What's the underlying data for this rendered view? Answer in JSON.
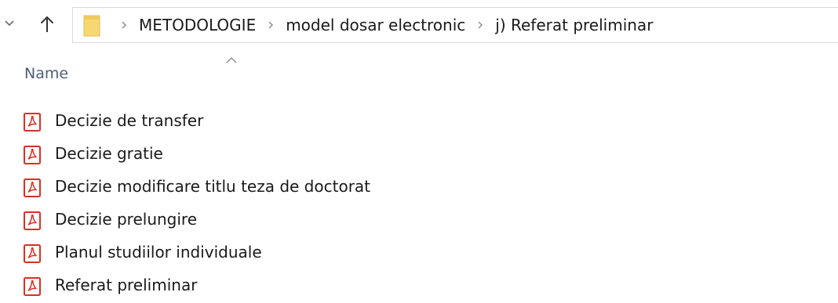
{
  "window": {
    "title": "j) Referat preliminar"
  },
  "address_bar": {
    "path": [
      "METODOLOGIE",
      "model dosar electronic",
      "j) Referat preliminar"
    ]
  },
  "column": {
    "name_label": "Name",
    "sort": "ascending"
  },
  "files": [
    {
      "name": "Decizie de transfer",
      "icon": "pdf-icon"
    },
    {
      "name": "Decizie gratie",
      "icon": "pdf-icon"
    },
    {
      "name": "Decizie modificare titlu teza de doctorat",
      "icon": "pdf-icon"
    },
    {
      "name": "Decizie prelungire",
      "icon": "pdf-icon"
    },
    {
      "name": "Planul studiilor individuale",
      "icon": "pdf-icon"
    },
    {
      "name": "Referat preliminar",
      "icon": "pdf-icon"
    }
  ],
  "colors": {
    "pdf_red": "#d93025",
    "folder_yellow": "#f7d774",
    "header_text": "#4c607a",
    "border": "#d9d9d9"
  }
}
